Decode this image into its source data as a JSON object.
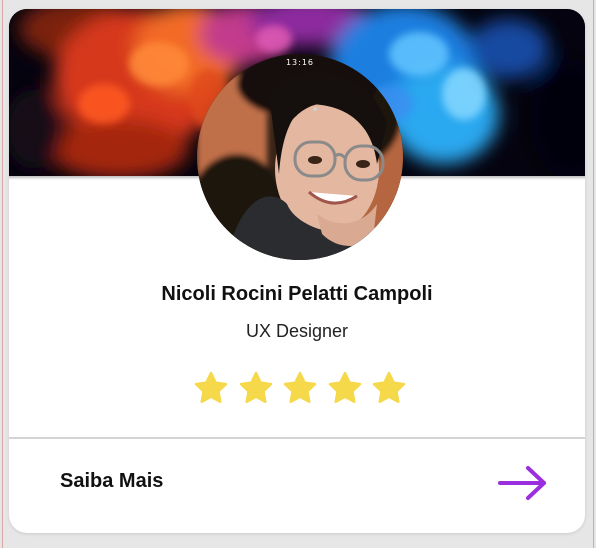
{
  "profile": {
    "name": "Nicoli Rocini Pelatti Campoli",
    "role": "UX Designer",
    "photo_timestamp": "13:16"
  },
  "rating": {
    "value": 5,
    "max": 5,
    "star_color": "#f5d94a"
  },
  "footer": {
    "more_label": "Saiba Mais",
    "arrow_icon": "arrow-right-icon",
    "arrow_color": "#9b2fe0"
  },
  "colors": {
    "card_background": "#ffffff",
    "page_background": "#e6e6e6",
    "banner_background": "#05030f"
  }
}
